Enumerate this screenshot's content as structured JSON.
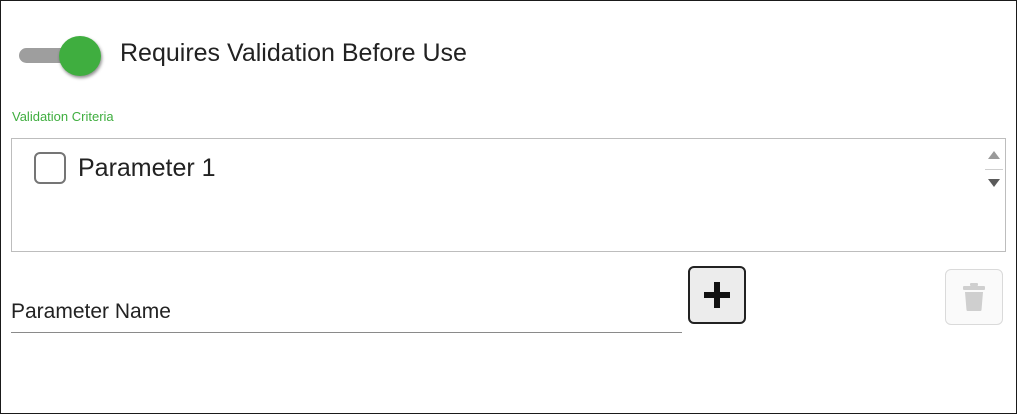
{
  "toggle": {
    "label": "Requires Validation Before Use",
    "checked": true,
    "on_color": "#3fae3f",
    "track_color": "#9e9e9e"
  },
  "validation_criteria": {
    "label": "Validation Criteria",
    "label_color": "#3fae3f",
    "items": [
      {
        "label": "Parameter 1",
        "checked": false
      }
    ]
  },
  "parameter_input": {
    "placeholder": "Parameter Name",
    "value": ""
  },
  "icons": {
    "add": "plus-icon",
    "delete": "trash-icon",
    "scroll_up": "arrow-up-icon",
    "scroll_down": "arrow-down-icon"
  }
}
